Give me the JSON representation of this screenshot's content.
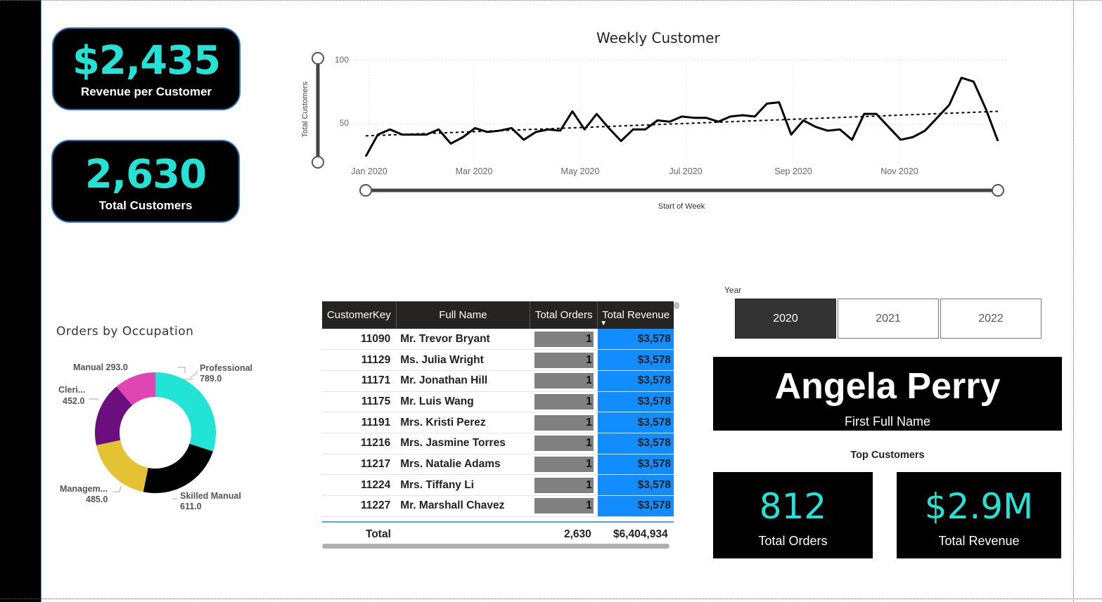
{
  "kpis": {
    "revenue_per_customer": {
      "value": "$2,435",
      "label": "Revenue per Customer"
    },
    "total_customers": {
      "value": "2,630",
      "label": "Total Customers"
    }
  },
  "weekly_chart": {
    "chart_data": {
      "type": "line",
      "title": "Weekly Customer",
      "xlabel": "Start of Week",
      "ylabel": "Total Customers",
      "y_ticks": [
        "100",
        "50"
      ],
      "ylim": [
        20,
        100
      ],
      "x_ticks": [
        "Jan 2020",
        "Mar 2020",
        "May 2020",
        "Jul 2020",
        "Sep 2020",
        "Nov 2020"
      ],
      "values": [
        25,
        42,
        46,
        42,
        42,
        42,
        46,
        35,
        40,
        47,
        44,
        45,
        47,
        38,
        44,
        46,
        45,
        60,
        46,
        58,
        47,
        37,
        46,
        46,
        53,
        52,
        56,
        55,
        55,
        52,
        56,
        57,
        56,
        66,
        67,
        42,
        53,
        48,
        45,
        46,
        38,
        58,
        58,
        48,
        38,
        40,
        45,
        55,
        65,
        86,
        83,
        62,
        37
      ],
      "trend_start": 41,
      "trend_end": 60,
      "grid": true,
      "legend": "none"
    }
  },
  "occupation_chart": {
    "title": "Orders by Occupation",
    "chart_data": {
      "type": "pie",
      "categories": [
        "Professional",
        "Skilled Manual",
        "Managem...",
        "Cleri...",
        "Manual"
      ],
      "values": [
        789.0,
        611.0,
        485.0,
        452.0,
        293.0
      ],
      "labels": [
        "789.0",
        "611.0",
        "485.0",
        "452.0",
        "293.0"
      ],
      "manual_label": "Manual 293.0",
      "colors": [
        "#21e3d6",
        "#000000",
        "#e3c334",
        "#6b0f7f",
        "#e046b3"
      ]
    }
  },
  "table": {
    "headers": [
      "CustomerKey",
      "Full Name",
      "Total Orders",
      "Total Revenue"
    ],
    "rows": [
      {
        "key": "11090",
        "name": "Mr. Trevor Bryant",
        "orders": "1",
        "revenue": "$3,578"
      },
      {
        "key": "11129",
        "name": "Ms. Julia Wright",
        "orders": "1",
        "revenue": "$3,578"
      },
      {
        "key": "11171",
        "name": "Mr. Jonathan Hill",
        "orders": "1",
        "revenue": "$3,578"
      },
      {
        "key": "11175",
        "name": "Mr. Luis Wang",
        "orders": "1",
        "revenue": "$3,578"
      },
      {
        "key": "11191",
        "name": "Mrs. Kristi Perez",
        "orders": "1",
        "revenue": "$3,578"
      },
      {
        "key": "11216",
        "name": "Mrs. Jasmine Torres",
        "orders": "1",
        "revenue": "$3,578"
      },
      {
        "key": "11217",
        "name": "Mrs. Natalie Adams",
        "orders": "1",
        "revenue": "$3,578"
      },
      {
        "key": "11224",
        "name": "Mrs. Tiffany Li",
        "orders": "1",
        "revenue": "$3,578"
      },
      {
        "key": "11227",
        "name": "Mr. Marshall Chavez",
        "orders": "1",
        "revenue": "$3,578"
      }
    ],
    "total_label": "Total",
    "total_orders": "2,630",
    "total_revenue": "$6,404,934"
  },
  "year_slicer": {
    "label": "Year",
    "options": [
      "2020",
      "2021",
      "2022"
    ],
    "selected": "2020"
  },
  "top_customer": {
    "name": "Angela Perry",
    "name_label": "First Full Name",
    "section_title": "Top Customers",
    "orders_value": "812",
    "orders_label": "Total Orders",
    "revenue_value": "$2.9M",
    "revenue_label": "Total Revenue"
  }
}
